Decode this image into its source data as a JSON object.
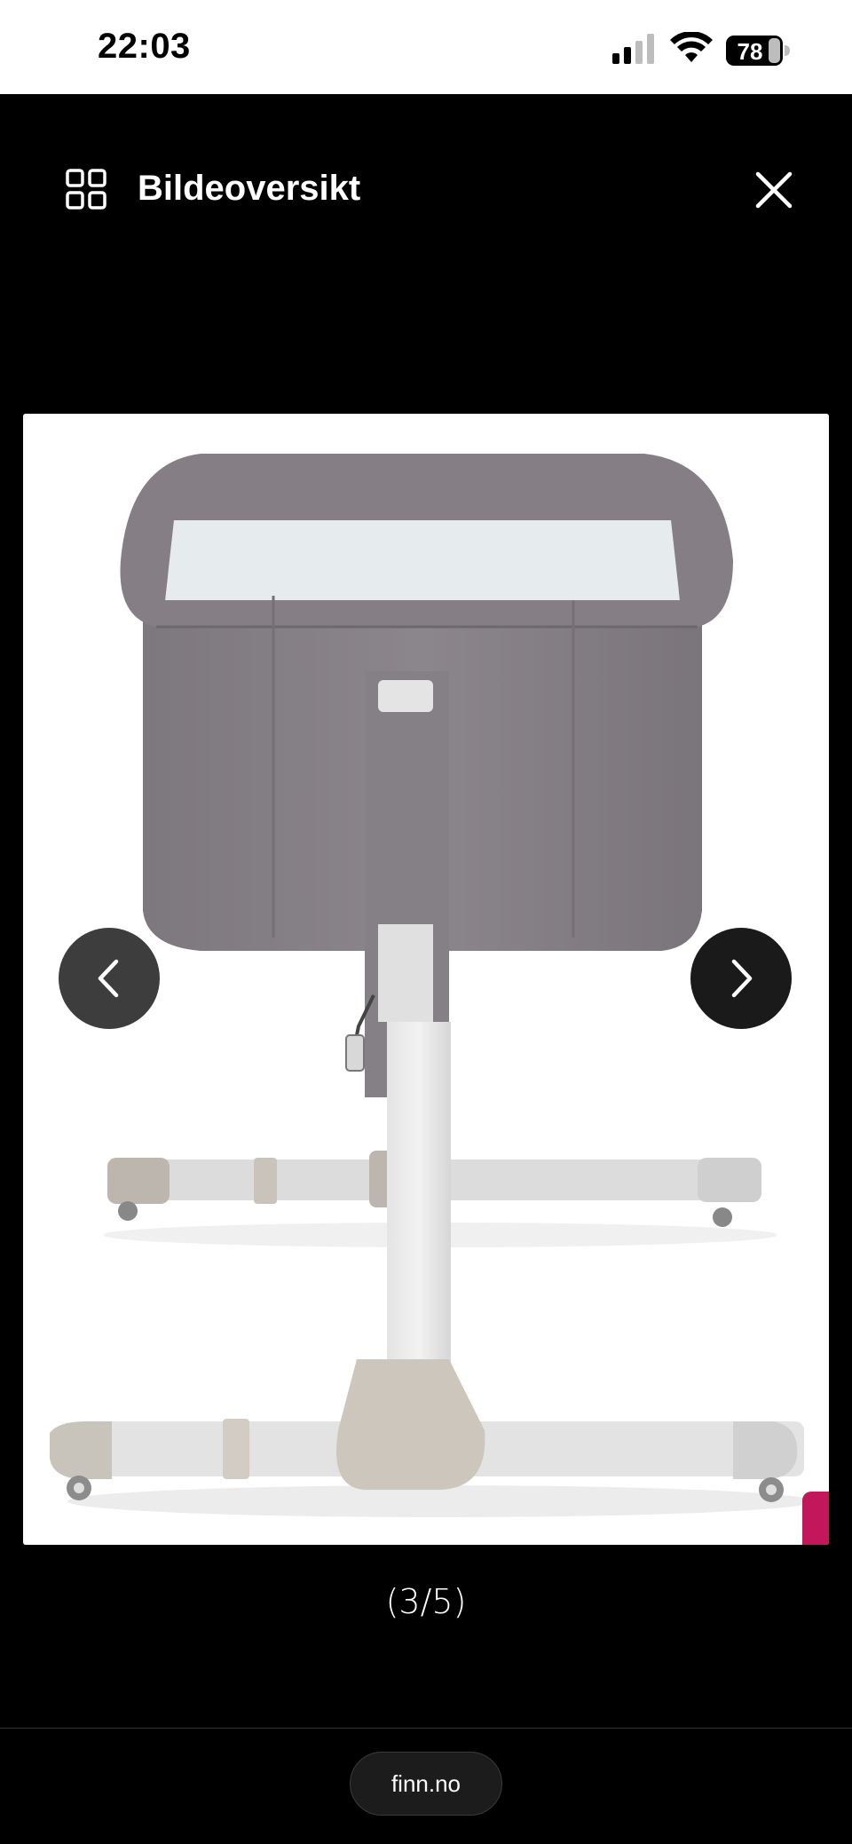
{
  "status_bar": {
    "time": "22:03",
    "battery_level": "78"
  },
  "header": {
    "title": "Bildeoversikt",
    "grid_icon": "grid-icon",
    "close_icon": "close-icon"
  },
  "gallery": {
    "counter": "(3/5)",
    "prev_icon": "chevron-left-icon",
    "next_icon": "chevron-right-icon"
  },
  "browser": {
    "url": "finn.no"
  },
  "colors": {
    "background": "#000000",
    "accent": "#c2185b"
  }
}
